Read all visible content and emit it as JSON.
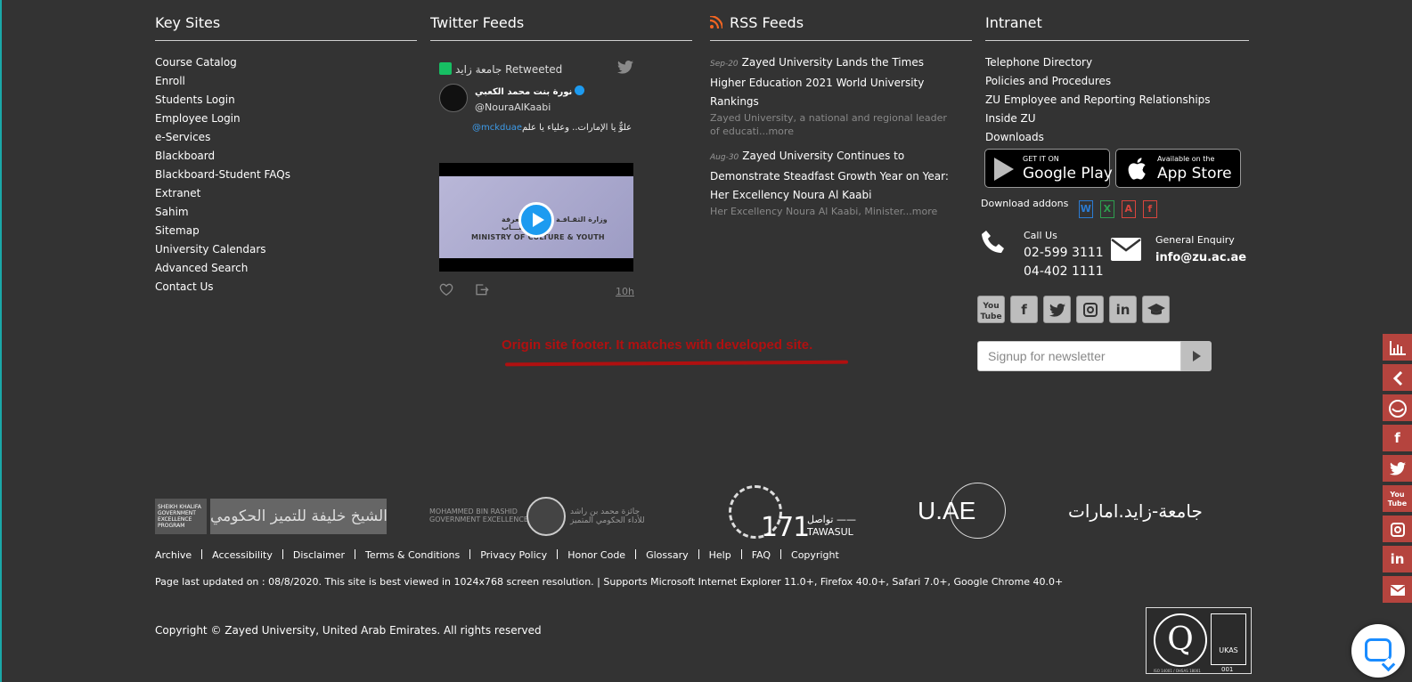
{
  "columns": {
    "key_sites": {
      "title": "Key Sites",
      "links": [
        "Course Catalog",
        "Enroll",
        "Students Login",
        "Employee Login",
        "e-Services",
        "Blackboard",
        "Blackboard-Student FAQs",
        "Extranet",
        "Sahim",
        "Sitemap",
        "University Calendars",
        "Advanced Search",
        "Contact Us"
      ]
    },
    "twitter": {
      "title": "Twitter Feeds",
      "retweeted_by": "جامعة زايد Retweeted",
      "author_name": "نورة بنت محمد الكعبي",
      "author_handle": "@NouraAlKaabi",
      "tweet_mention": "@mckduae",
      "tweet_text": "علوٌّ يا الإمارات.. وعلياء يا علم",
      "video_text_ar": "وزارة الثقـافـة وتنمية المعرفة والشبـــاب",
      "video_text_en": "MINISTRY OF CULTURE & YOUTH",
      "time": "10h"
    },
    "rss": {
      "title": "RSS Feeds",
      "items": [
        {
          "date": "Sep-20",
          "title": "Zayed University Lands the Times Higher Education 2021 World University Rankings",
          "desc": "Zayed University, a national and regional leader of educati...",
          "more": "more"
        },
        {
          "date": "Aug-30",
          "title": "Zayed University Continues to Demonstrate Steadfast Growth Year on Year: Her Excellency Noura Al Kaabi",
          "desc": "Her Excellency Noura Al Kaabi, Minister...",
          "more": "more"
        }
      ]
    },
    "intranet": {
      "title": "Intranet",
      "links": [
        "Telephone Directory",
        "Policies and Procedures",
        "ZU Employee and Reporting Relationships",
        "Inside ZU",
        "Downloads"
      ],
      "google_play_small": "GET IT ON",
      "google_play_big": "Google Play",
      "app_store_small": "Available on the",
      "app_store_big": "App Store",
      "download_addons": "Download addons",
      "call_label": "Call Us",
      "call_numbers": [
        "02-599 3111",
        "04-402 1111"
      ],
      "enquiry_label": "General Enquiry",
      "enquiry_email": "info@zu.ac.ae",
      "newsletter_placeholder": "Signup for newsletter"
    }
  },
  "annotation": "Origin site footer. It matches with developed site.",
  "logos": {
    "program_left": "SHEIKH KHALIFA GOVERNMENT EXCELLENCE PROGRAM",
    "program_right": "برنامج الشيخ خليفة للتميز الحكومي",
    "mbr_en": "MOHAMMED BIN RASHID\nGOVERNMENT EXCELLENCE AWARD",
    "mbr_ar": "جائزة محمد بن راشد\nللأداء الحكومي المتميز",
    "tawasul_num": "171",
    "tawasul_ar": "تواصل ——",
    "tawasul_en": "TAWASUL",
    "uae": "U.AE",
    "zu_ar": "جامعة-زايد.امارات"
  },
  "footer": {
    "links": [
      "Archive",
      "Accessibility",
      "Disclaimer",
      "Terms & Conditions",
      "Privacy Policy",
      "Honor Code",
      "Glossary",
      "Help",
      "FAQ",
      "Copyright"
    ],
    "last_updated": "Page last updated on : 08/8/2020. This site is best viewed in 1024x768 screen resolution. | Supports Microsoft Internet Explorer 11.0+, Firefox 40.0+, Safari 7.0+, Google Chrome 40.0+",
    "copyright": "Copyright © Zayed University, United Arab Emirates. All rights reserved",
    "cert_text": "ISO 14001 / OHSAS 18001",
    "cert_ukas": "UKAS",
    "cert_num": "001"
  },
  "colors": {
    "background": "#333333",
    "sidebar": "#b5443e",
    "annotation": "#b01010",
    "twitter_blue": "#1d9bf0"
  },
  "sidebar_icons": [
    "chart-icon",
    "chevron-left-icon",
    "share-icon",
    "facebook-icon",
    "twitter-icon",
    "youtube-icon",
    "instagram-icon",
    "linkedin-icon",
    "envelope-icon"
  ],
  "social_icons": [
    "youtube-icon",
    "facebook-icon",
    "twitter-icon",
    "instagram-icon",
    "linkedin-icon",
    "graduation-cap-icon"
  ]
}
